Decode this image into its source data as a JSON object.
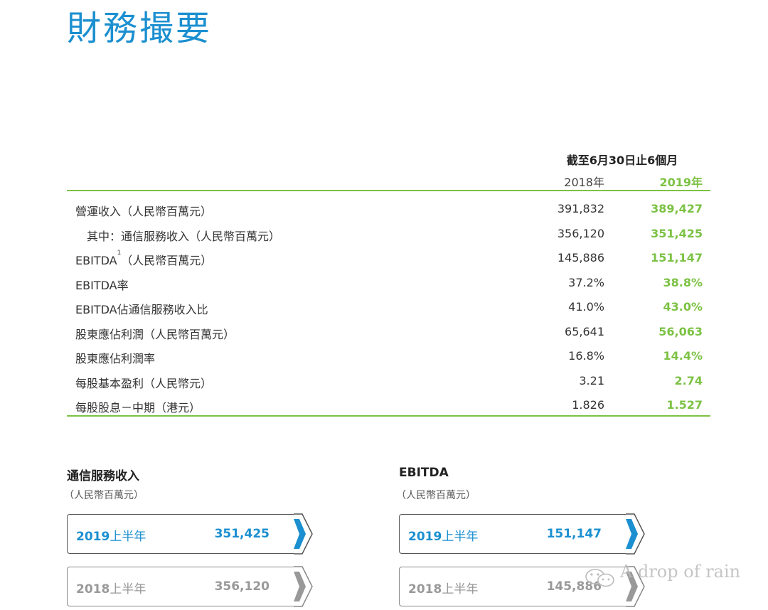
{
  "title": "財務撮要",
  "table": {
    "period_header": "截至6月30日止6個月",
    "year_prev": "2018年",
    "year_cur": "2019年",
    "rows": [
      {
        "label": "營運收入（人民幣百萬元）",
        "prev": "391,832",
        "cur": "389,427",
        "indent": false,
        "sup": ""
      },
      {
        "label": "其中：通信服務收入（人民幣百萬元）",
        "prev": "356,120",
        "cur": "351,425",
        "indent": true,
        "sup": ""
      },
      {
        "label": "EBITDA",
        "sup": "1",
        "label_suffix": "（人民幣百萬元）",
        "prev": "145,886",
        "cur": "151,147",
        "indent": false
      },
      {
        "label": "EBITDA率",
        "prev": "37.2%",
        "cur": "38.8%",
        "indent": false,
        "sup": ""
      },
      {
        "label": "EBITDA佔通信服務收入比",
        "prev": "41.0%",
        "cur": "43.0%",
        "indent": false,
        "sup": ""
      },
      {
        "label": "股東應佔利潤（人民幣百萬元）",
        "prev": "65,641",
        "cur": "56,063",
        "indent": false,
        "sup": ""
      },
      {
        "label": "股東應佔利潤率",
        "prev": "16.8%",
        "cur": "14.4%",
        "indent": false,
        "sup": ""
      },
      {
        "label": "每股基本盈利（人民幣元）",
        "prev": "3.21",
        "cur": "2.74",
        "indent": false,
        "sup": ""
      },
      {
        "label": "每股股息－中期（港元）",
        "prev": "1.826",
        "cur": "1.527",
        "indent": false,
        "sup": ""
      }
    ]
  },
  "sections": [
    {
      "title": "通信服務收入",
      "unit": "（人民幣百萬元）",
      "cur": {
        "year": "2019",
        "half": "上半年",
        "value": "351,425"
      },
      "prev": {
        "year": "2018",
        "half": "上半年",
        "value": "356,120"
      }
    },
    {
      "title": "EBITDA",
      "unit": "（人民幣百萬元）",
      "cur": {
        "year": "2019",
        "half": "上半年",
        "value": "151,147"
      },
      "prev": {
        "year": "2018",
        "half": "上半年",
        "value": "145,886"
      }
    }
  ],
  "colors": {
    "blue": "#1b8fd0",
    "green": "#7cc244",
    "grey": "#999999"
  },
  "watermark": "A drop of rain"
}
